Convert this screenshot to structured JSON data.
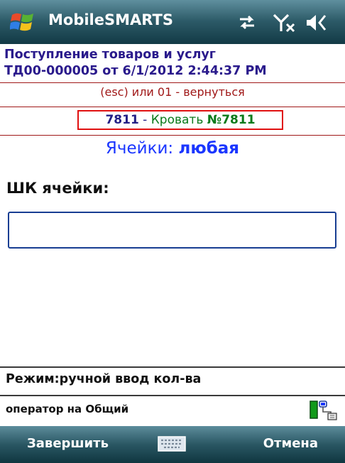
{
  "titlebar": {
    "app_title": "MobileSMARTS",
    "icons": [
      "windows-start-icon",
      "sync-icon",
      "signal-off-icon",
      "volume-icon"
    ]
  },
  "document": {
    "line1": "Поступление товаров и услуг",
    "line2": "ТД00-000005 от 6/1/2012 2:44:37 PM"
  },
  "back_hint": "(esc) или 01 - вернуться",
  "item": {
    "code": "7811",
    "separator": " - ",
    "name_prefix": "Кровать ",
    "name_number": "№7811"
  },
  "cells": {
    "label": "Ячейки: ",
    "value": "любая"
  },
  "barcode_field": {
    "label": "ШК ячейки:",
    "value": "",
    "placeholder": ""
  },
  "mode": "Режим:ручной ввод кол-ва",
  "operator": "оператор на Общий",
  "softkeys": {
    "left": "Завершить",
    "right": "Отмена",
    "center_icon": "keyboard-icon"
  },
  "colors": {
    "header_text": "#2a1a8c",
    "hint_red": "#a01818",
    "item_border": "#e01010",
    "item_green": "#0a7a1a",
    "cells_blue": "#1a36ff",
    "bar_top": "#5f8f9e",
    "bar_bottom": "#123a45"
  }
}
